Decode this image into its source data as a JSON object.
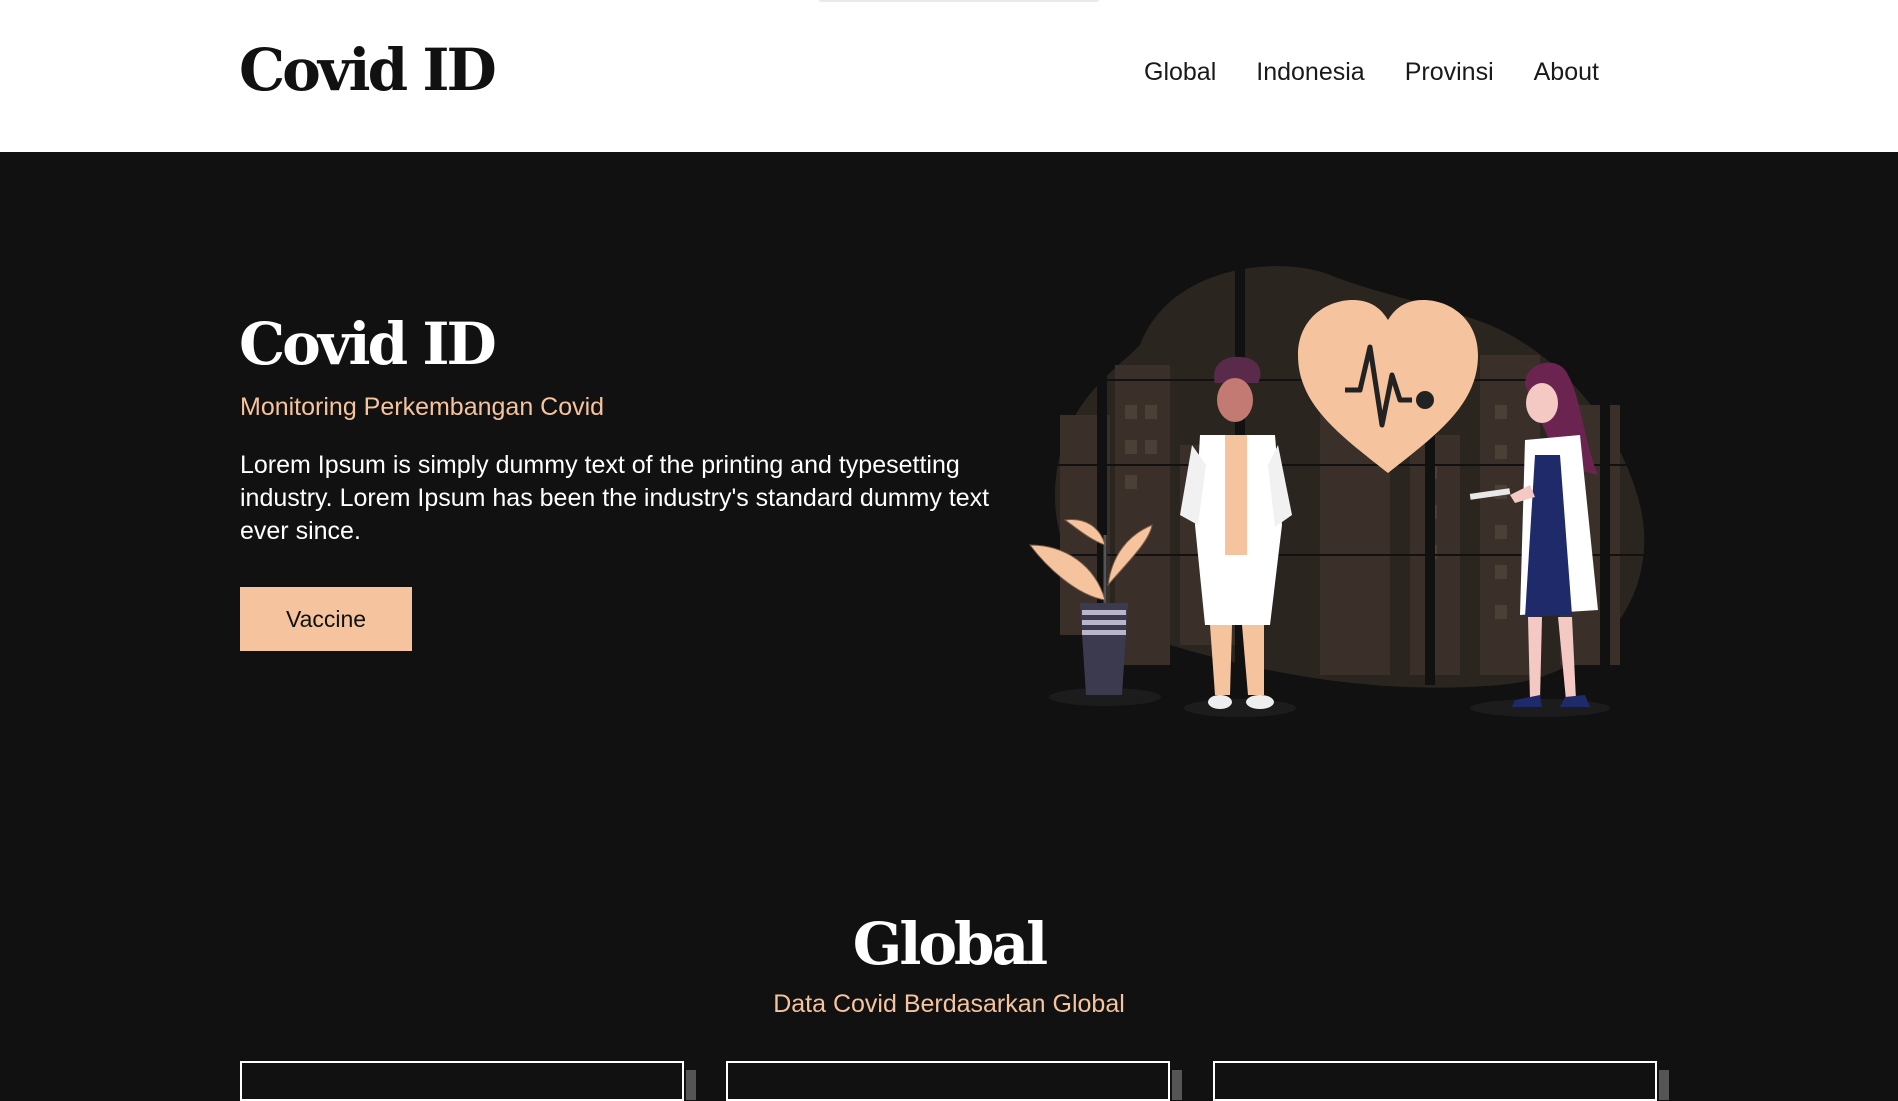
{
  "header": {
    "brand": "Covid ID",
    "nav": [
      "Global",
      "Indonesia",
      "Provinsi",
      "About"
    ]
  },
  "hero": {
    "title": "Covid ID",
    "subtitle": "Monitoring Perkembangan Covid",
    "body": "Lorem Ipsum is simply dummy text of the printing and typesetting industry. Lorem Ipsum has been the industry's standard dummy text ever since.",
    "button": "Vaccine"
  },
  "global": {
    "title": "Global",
    "subtitle": "Data Covid Berdasarkan Global"
  },
  "colors": {
    "background": "#111111",
    "accent": "#f5c39d",
    "header_bg": "#ffffff"
  },
  "icons": [
    "heart-pulse-icon"
  ]
}
